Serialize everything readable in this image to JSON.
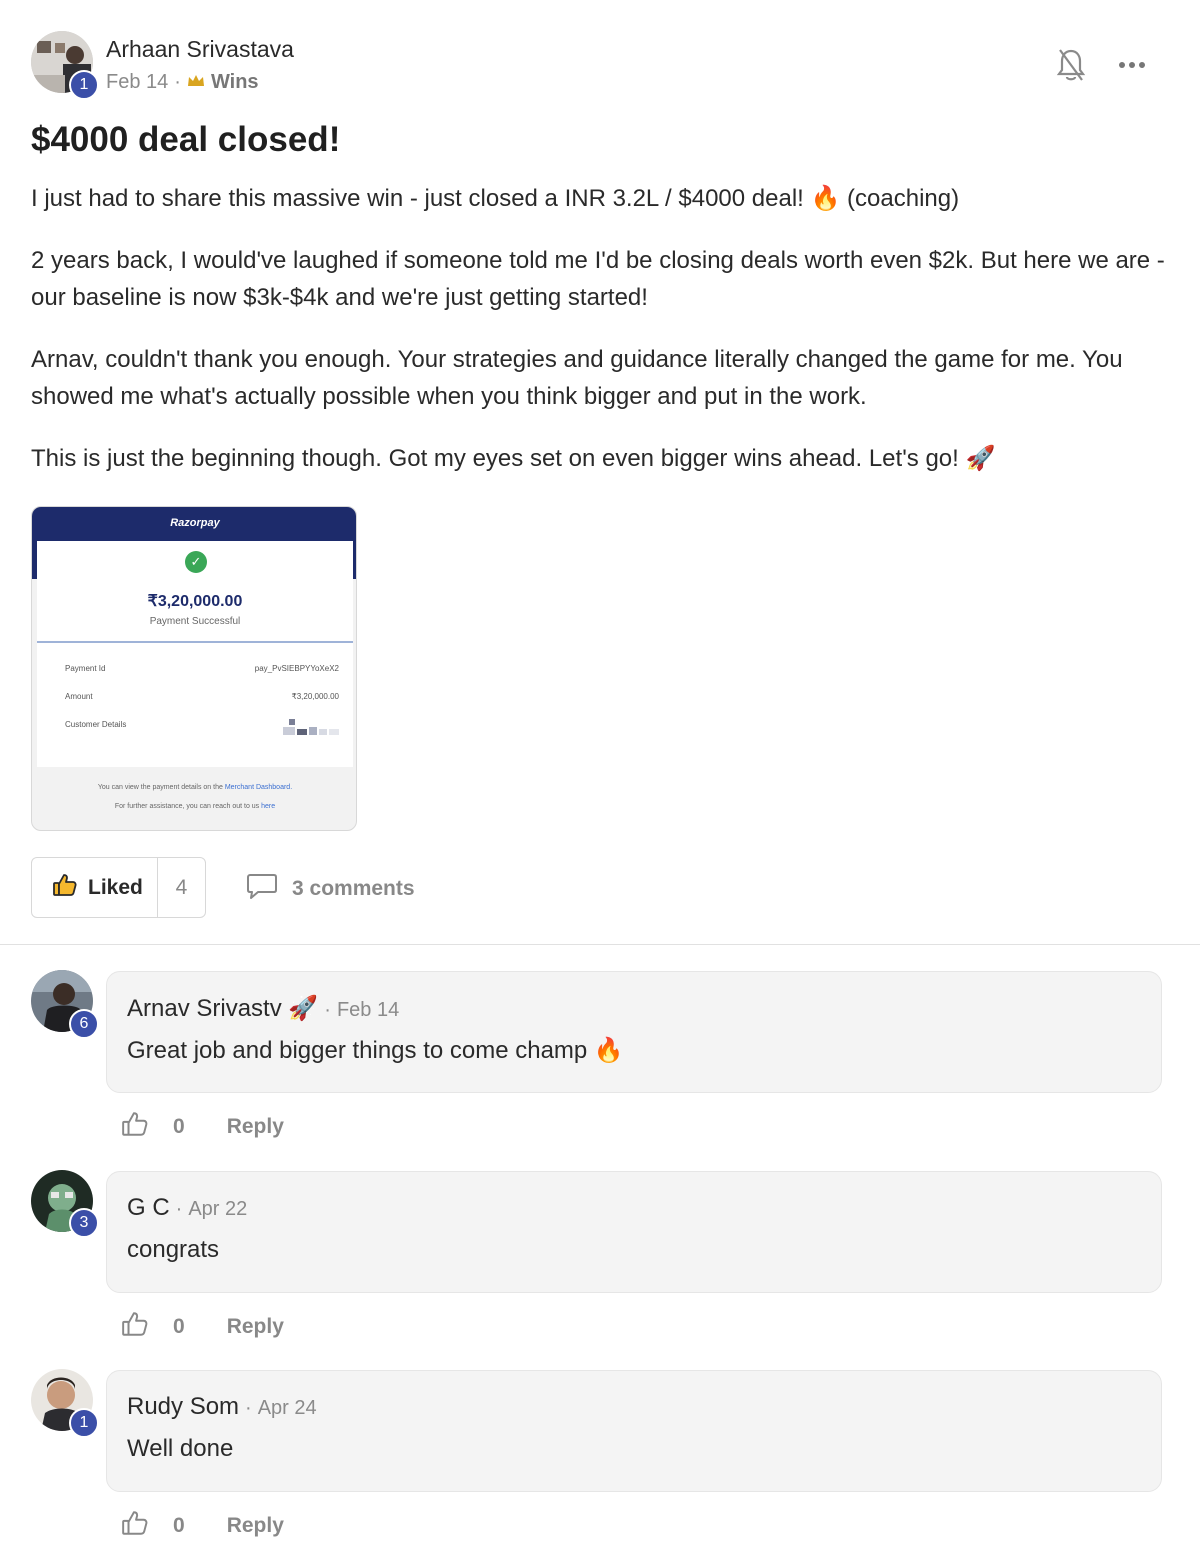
{
  "post": {
    "author": "Arhaan Srivastava",
    "author_level": "1",
    "date": "Feb 14",
    "category": "Wins",
    "title": "$4000 deal closed!",
    "paragraphs": [
      "I just had to share this massive win - just closed a INR 3.2L / $4000 deal! 🔥 (coaching)",
      "2 years back, I would've laughed if someone told me I'd be closing deals worth even $2k. But here we are - our baseline is now $3k-$4k and we're just getting started!",
      "Arnav, couldn't thank you enough. Your strategies and guidance literally changed the game for me. You showed me what's actually possible when you think bigger and put in the work.",
      "This is just the beginning though. Got my eyes set on even bigger wins ahead. Let's go! 🚀"
    ],
    "liked_label": "Liked",
    "like_count": "4",
    "comments_label": "3 comments"
  },
  "receipt": {
    "brand": "Razorpay",
    "amount": "₹3,20,000.00",
    "status": "Payment Successful",
    "payment_id_label": "Payment Id",
    "payment_id_value": "pay_PvSIEBPYYoXeX2",
    "amount_label": "Amount",
    "amount_value": "₹3,20,000.00",
    "customer_label": "Customer Details",
    "footer_1_prefix": "You can view the payment details on the",
    "footer_1_link": "Merchant Dashboard.",
    "footer_2_prefix": "For further assistance, you can reach out to us",
    "footer_2_link": "here"
  },
  "comments": [
    {
      "name": "Arnav Srivastv 🚀",
      "level": "6",
      "date": "Feb 14",
      "text": "Great job and bigger things to come champ 🔥",
      "likes": "0",
      "reply": "Reply"
    },
    {
      "name": "G C",
      "level": "3",
      "date": "Apr 22",
      "text": "congrats",
      "likes": "0",
      "reply": "Reply"
    },
    {
      "name": "Rudy Som",
      "level": "1",
      "date": "Apr 24",
      "text": "Well done",
      "likes": "0",
      "reply": "Reply"
    }
  ],
  "icons": {
    "bell": "bell-off-icon",
    "more": "more-horizontal-icon",
    "like": "thumbs-up-icon",
    "comment": "chat-bubble-icon",
    "check": "check-circle-icon"
  },
  "colors": {
    "level_badge": "#3b4fa8",
    "razorpay_header": "#1d2b6b",
    "success": "#3aa757"
  }
}
